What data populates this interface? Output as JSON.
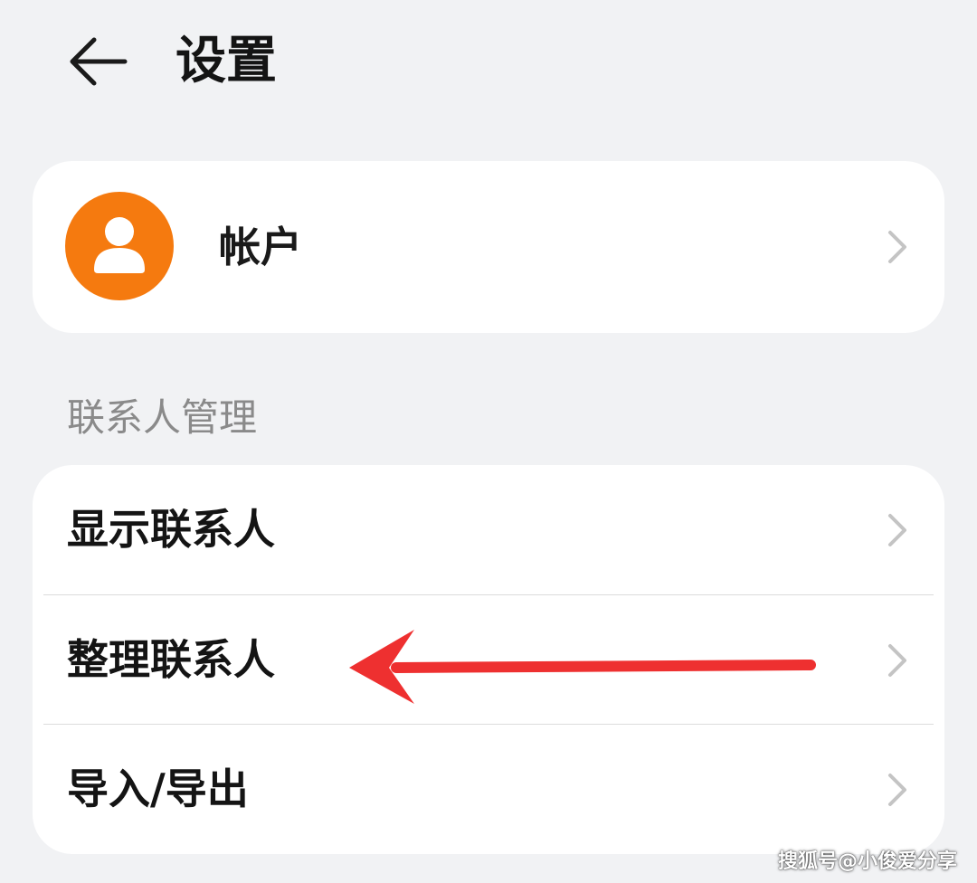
{
  "header": {
    "back_icon": "arrow-left-icon",
    "title": "设置"
  },
  "account": {
    "avatar_icon": "person-icon",
    "avatar_color": "#f57a0f",
    "label": "帐户",
    "chevron_icon": "chevron-right-icon"
  },
  "contacts_section": {
    "header": "联系人管理",
    "items": [
      {
        "label": "显示联系人",
        "icon": "chevron-right-icon"
      },
      {
        "label": "整理联系人",
        "icon": "chevron-right-icon"
      },
      {
        "label": "导入/导出",
        "icon": "chevron-right-icon"
      }
    ]
  },
  "annotation": {
    "arrow_color": "#ee3030",
    "points_to": "整理联系人"
  },
  "watermark": "搜狐号@小俊爱分享",
  "colors": {
    "background": "#f1f2f4",
    "card": "#ffffff",
    "section_header": "#8a8a8a"
  }
}
